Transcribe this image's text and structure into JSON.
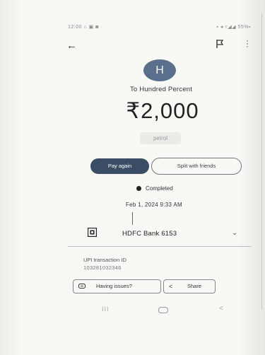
{
  "status_bar": {
    "time": "12:00 ⌂ ▣ ◙ ·",
    "right": "▪ ◂ ▿◢◢ 55%▪"
  },
  "icons": {
    "back": "back-arrow-icon",
    "flag": "flag-icon",
    "more": "more-vert-icon",
    "bank": "bank-logo-icon",
    "chevron": "chevron-down-icon",
    "issues": "chat-icon",
    "share": "share-icon"
  },
  "avatar": {
    "initial": "H",
    "color": "#5a6f8c"
  },
  "payee": "To Hundred Percent",
  "amount": "₹2,000",
  "note": "petrol",
  "actions": {
    "pay_again": "Pay again",
    "split": "Split with friends"
  },
  "status": "Completed",
  "datetime": "Feb 1, 2024 9:33 AM",
  "bank": {
    "name": "HDFC Bank 6153"
  },
  "upi": {
    "label": "UPI transaction ID",
    "value": "103281032346"
  },
  "buttons": {
    "issues": "Having issues?",
    "share": "Share"
  },
  "navbar": {
    "recent": "III",
    "back": "<"
  }
}
